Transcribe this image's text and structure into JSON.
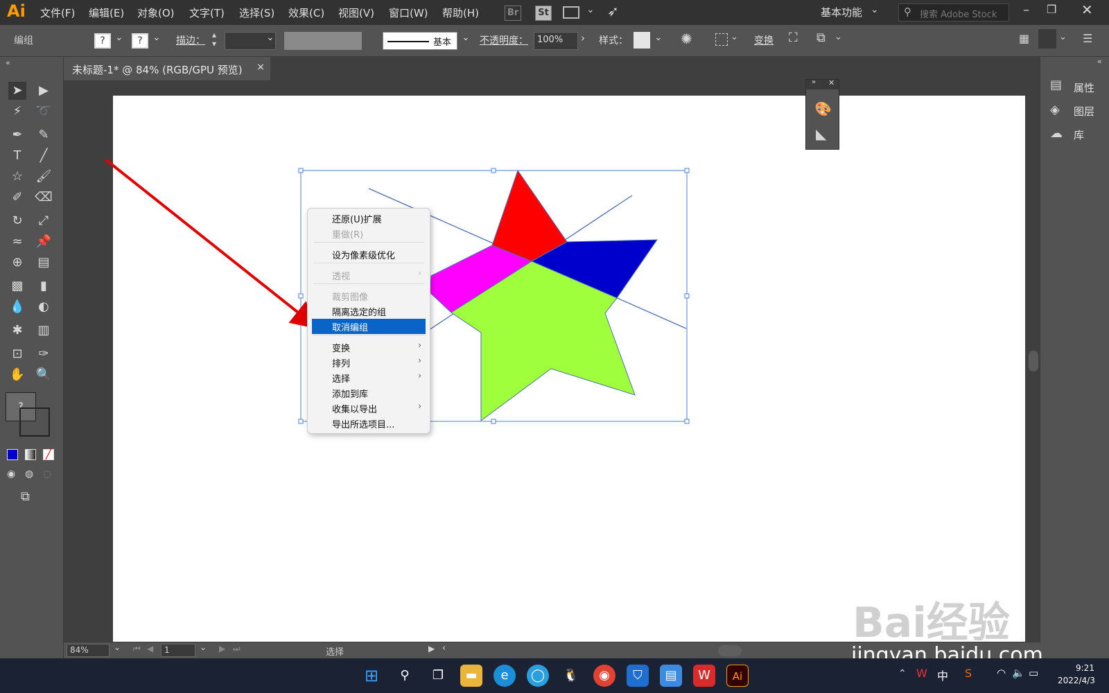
{
  "app": {
    "logo": "Ai"
  },
  "menubar": {
    "items": [
      "文件(F)",
      "编辑(E)",
      "对象(O)",
      "文字(T)",
      "选择(S)",
      "效果(C)",
      "视图(V)",
      "窗口(W)",
      "帮助(H)"
    ],
    "bridge": "Br",
    "stock": "St",
    "workspace": "基本功能",
    "search_placeholder": "搜索 Adobe Stock"
  },
  "controlbar": {
    "selection_label": "编组",
    "fill_q": "?",
    "stroke_q": "?",
    "stroke_label": "描边：",
    "stroke_style": "基本",
    "opacity_label": "不透明度：",
    "opacity_value": "100%",
    "style_label": "样式：",
    "transform_label": "变换"
  },
  "document": {
    "tab_title": "未标题-1* @ 84% (RGB/GPU 预览)",
    "close": "×"
  },
  "right_panel": {
    "items": [
      "属性",
      "图层",
      "库"
    ]
  },
  "statusbar": {
    "zoom": "84%",
    "page": "1",
    "tool": "选择"
  },
  "context_menu": {
    "items": [
      {
        "label": "还原(U)扩展",
        "disabled": false
      },
      {
        "label": "重做(R)",
        "disabled": true
      },
      {
        "label": "设为像素级优化",
        "disabled": false
      },
      {
        "label": "透视",
        "disabled": true,
        "submenu": true
      },
      {
        "label": "裁剪图像",
        "disabled": true
      },
      {
        "label": "隔离选定的组",
        "disabled": false
      },
      {
        "label": "取消编组",
        "disabled": false,
        "highlighted": true
      },
      {
        "label": "变换",
        "disabled": false,
        "submenu": true
      },
      {
        "label": "排列",
        "disabled": false,
        "submenu": true
      },
      {
        "label": "选择",
        "disabled": false,
        "submenu": true
      },
      {
        "label": "添加到库",
        "disabled": false
      },
      {
        "label": "收集以导出",
        "disabled": false,
        "submenu": true
      },
      {
        "label": "导出所选项目...",
        "disabled": false
      }
    ],
    "submenu_arrow": "›"
  },
  "colors": {
    "accent": "#0a64c8",
    "star_red": "#ff0000",
    "star_blue": "#0000cc",
    "star_magenta": "#ff00ff",
    "star_green": "#a0ff3c",
    "selection": "#4a7fd4"
  },
  "taskbar": {
    "time": "9:21",
    "date": "2022/4/3",
    "ime": "中"
  },
  "watermark": {
    "text": "Bai经验",
    "url": "jingyan.baidu.com"
  }
}
